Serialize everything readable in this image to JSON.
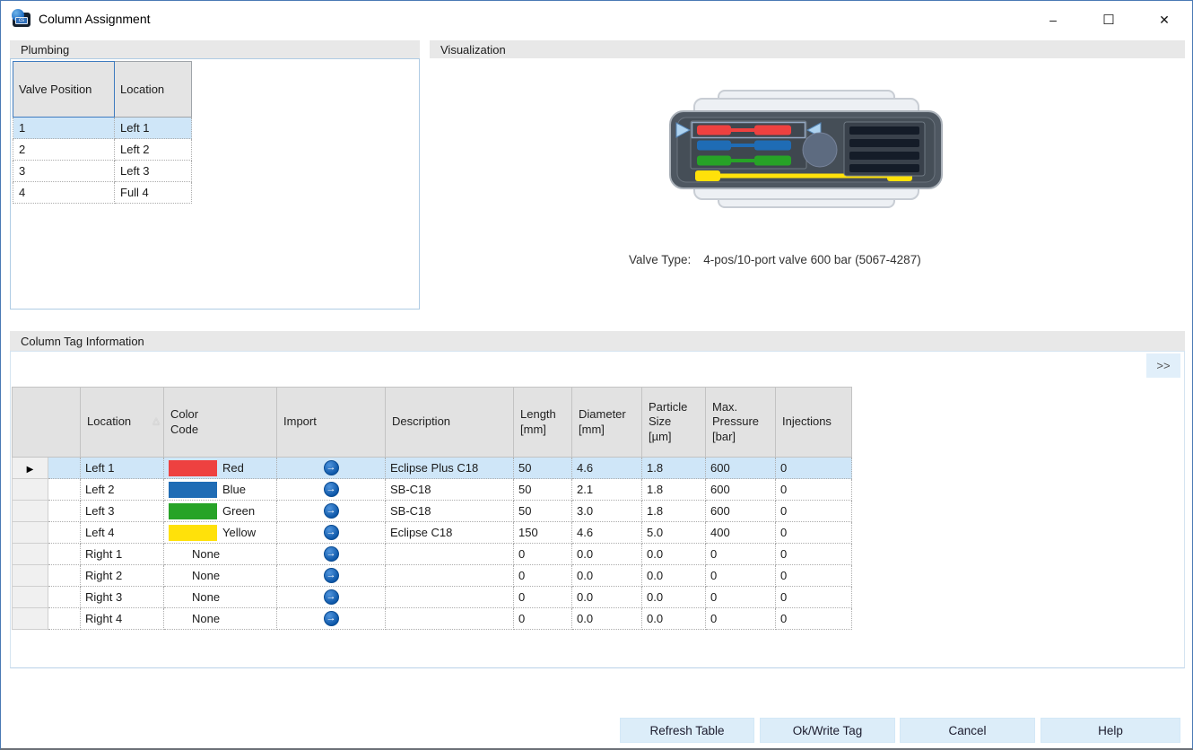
{
  "window": {
    "title": "Column Assignment",
    "minimize_glyph": "–",
    "maximize_glyph": "☐",
    "close_glyph": "✕"
  },
  "plumbing": {
    "title": "Plumbing",
    "columns": [
      "Valve Position",
      "Location"
    ],
    "rows": [
      {
        "valve_position": "1",
        "location": "Left 1",
        "selected": true
      },
      {
        "valve_position": "2",
        "location": "Left 2",
        "selected": false
      },
      {
        "valve_position": "3",
        "location": "Left 3",
        "selected": false
      },
      {
        "valve_position": "4",
        "location": "Full 4",
        "selected": false
      }
    ]
  },
  "visualization": {
    "title": "Visualization",
    "valve_type_label": "Valve Type:",
    "valve_type_value": "4-pos/10-port valve 600 bar (5067-4287)",
    "selected_position": "red",
    "colors": {
      "red": "#ee4140",
      "blue": "#1f6cb5",
      "green": "#27a327",
      "yellow": "#ffe10a"
    }
  },
  "column_tag": {
    "title": "Column Tag Information",
    "expand_button_label": ">>",
    "headers": [
      "",
      "Location",
      "Color\nCode",
      "Import",
      "Description",
      "Length\n[mm]",
      "Diameter\n[mm]",
      "Particle\nSize\n[µm]",
      "Max.\nPressure\n[bar]",
      "Injections"
    ],
    "rows": [
      {
        "location": "Left 1",
        "color_code": "Red",
        "color": "#ee4140",
        "description": "Eclipse Plus C18",
        "length_mm": "50",
        "diameter_mm": "4.6",
        "particle_size_um": "1.8",
        "max_pressure_bar": "600",
        "injections": "0",
        "selected": true
      },
      {
        "location": "Left 2",
        "color_code": "Blue",
        "color": "#1f6cb5",
        "description": "SB-C18",
        "length_mm": "50",
        "diameter_mm": "2.1",
        "particle_size_um": "1.8",
        "max_pressure_bar": "600",
        "injections": "0",
        "selected": false
      },
      {
        "location": "Left 3",
        "color_code": "Green",
        "color": "#27a327",
        "description": "SB-C18",
        "length_mm": "50",
        "diameter_mm": "3.0",
        "particle_size_um": "1.8",
        "max_pressure_bar": "600",
        "injections": "0",
        "selected": false
      },
      {
        "location": "Left 4",
        "color_code": "Yellow",
        "color": "#ffe10a",
        "description": "Eclipse C18",
        "length_mm": "150",
        "diameter_mm": "4.6",
        "particle_size_um": "5.0",
        "max_pressure_bar": "400",
        "injections": "0",
        "selected": false
      },
      {
        "location": "Right 1",
        "color_code": "None",
        "color": null,
        "description": "",
        "length_mm": "0",
        "diameter_mm": "0.0",
        "particle_size_um": "0.0",
        "max_pressure_bar": "0",
        "injections": "0",
        "selected": false
      },
      {
        "location": "Right 2",
        "color_code": "None",
        "color": null,
        "description": "",
        "length_mm": "0",
        "diameter_mm": "0.0",
        "particle_size_um": "0.0",
        "max_pressure_bar": "0",
        "injections": "0",
        "selected": false
      },
      {
        "location": "Right 3",
        "color_code": "None",
        "color": null,
        "description": "",
        "length_mm": "0",
        "diameter_mm": "0.0",
        "particle_size_um": "0.0",
        "max_pressure_bar": "0",
        "injections": "0",
        "selected": false
      },
      {
        "location": "Right 4",
        "color_code": "None",
        "color": null,
        "description": "",
        "length_mm": "0",
        "diameter_mm": "0.0",
        "particle_size_um": "0.0",
        "max_pressure_bar": "0",
        "injections": "0",
        "selected": false
      }
    ]
  },
  "footer_buttons": {
    "refresh": "Refresh Table",
    "ok_write": "Ok/Write Tag",
    "cancel": "Cancel",
    "help": "Help"
  }
}
